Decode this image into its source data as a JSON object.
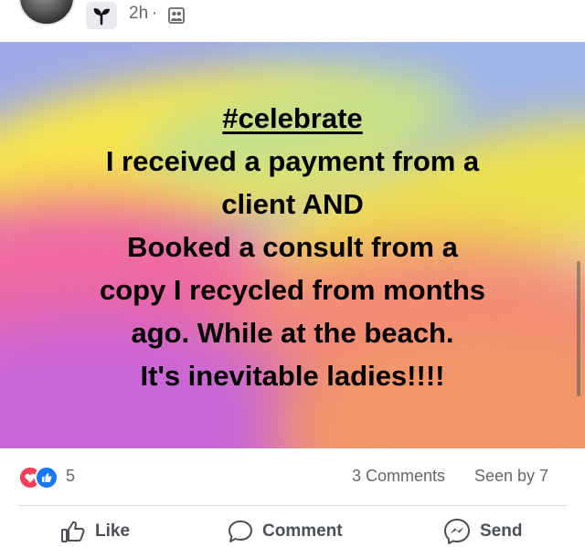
{
  "header": {
    "time": "2h"
  },
  "post": {
    "hashtag": "#celebrate",
    "lines": [
      "I received a payment from a",
      "client AND",
      "Booked a consult from a",
      "copy I recycled from months",
      "ago. While at the beach.",
      "It's inevitable ladies!!!!"
    ]
  },
  "engagement": {
    "reaction_count": "5",
    "comments": "3 Comments",
    "seen_by": "Seen by 7"
  },
  "actions": {
    "like": "Like",
    "comment": "Comment",
    "send": "Send"
  },
  "colors": {
    "heart_reaction": "#f33e58",
    "like_reaction": "#1877f2",
    "secondary_text": "#65676b"
  },
  "icons": [
    "sprout-icon",
    "audience-icon",
    "heart-reaction-icon",
    "like-reaction-icon",
    "thumbs-up-icon",
    "comment-icon",
    "messenger-icon"
  ]
}
